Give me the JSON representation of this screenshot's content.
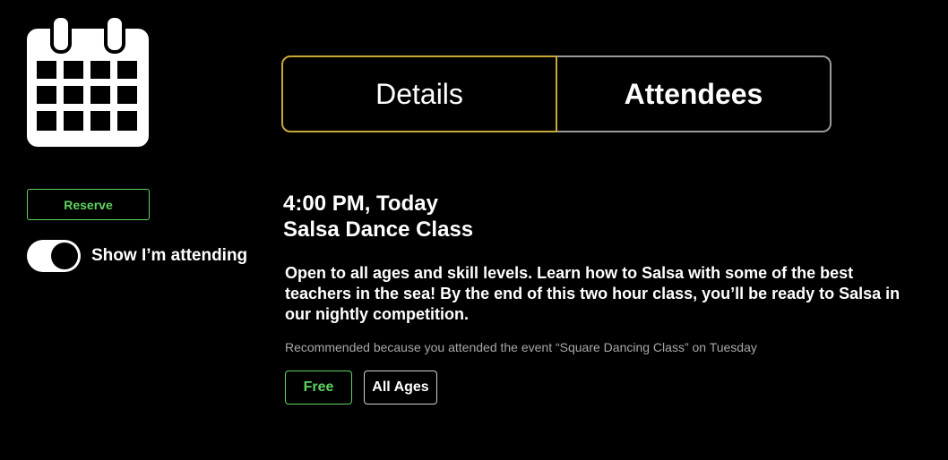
{
  "sidebar": {
    "icon": "calendar-icon",
    "reserve_label": "Reserve",
    "attending_toggle": {
      "label": "Show I’m attending",
      "on": true
    }
  },
  "tabs": [
    {
      "label": "Details",
      "active": true
    },
    {
      "label": "Attendees",
      "active": false
    }
  ],
  "event": {
    "time": "4:00 PM, Today",
    "title": "Salsa Dance Class",
    "description": "Open to all ages and skill levels. Learn how to Salsa with some of the best teachers in the sea! By the end of this two hour class, you’ll be ready to Salsa in our nightly competition.",
    "recommendation": "Recommended because you attended the event “Square Dancing Class” on Tuesday",
    "tags": [
      {
        "label": "Free",
        "color": "#5fd35f"
      },
      {
        "label": "All Ages",
        "color": "#ffffff"
      }
    ]
  },
  "colors": {
    "background": "#000000",
    "accent_green": "#5fd35f",
    "active_tab_border": "#c9a83a",
    "inactive_tab_border": "#9a9a9a"
  }
}
